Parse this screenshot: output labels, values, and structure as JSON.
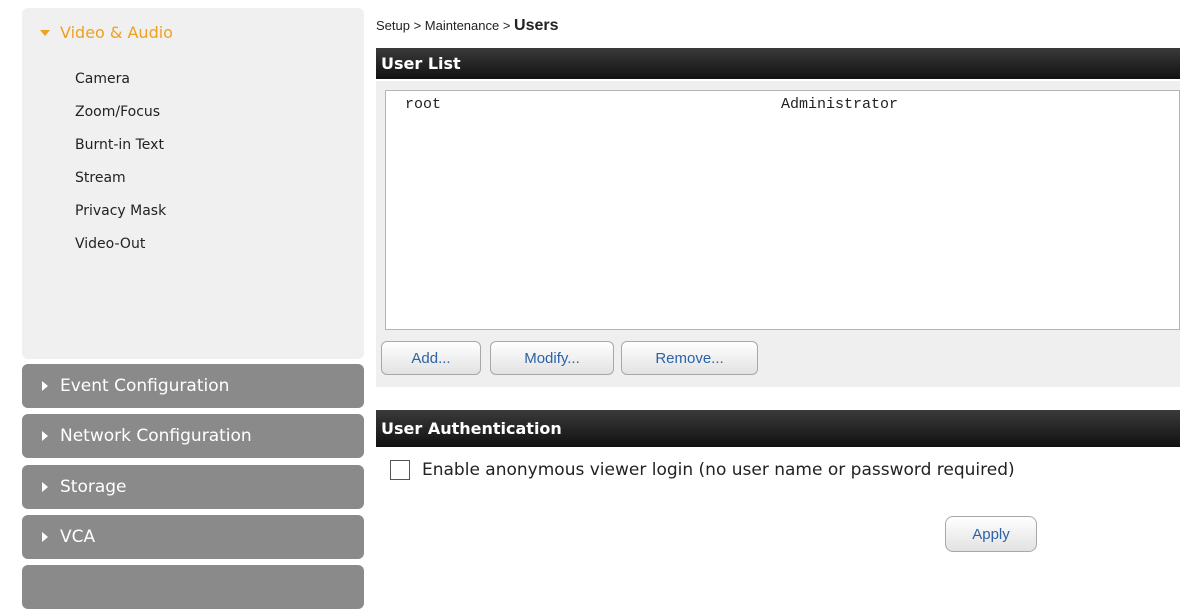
{
  "sidebar": {
    "open_section": {
      "label": "Video & Audio",
      "items": [
        "Camera",
        "Zoom/Focus",
        "Burnt-in Text",
        "Stream",
        "Privacy Mask",
        "Video-Out"
      ]
    },
    "closed_sections": [
      "Event Configuration",
      "Network Configuration",
      "Storage",
      "VCA"
    ]
  },
  "breadcrumb": {
    "path": "Setup > Maintenance > ",
    "current": "Users"
  },
  "user_list": {
    "title": "User List",
    "users": [
      {
        "name": "root",
        "role": "Administrator"
      }
    ],
    "buttons": {
      "add": "Add...",
      "modify": "Modify...",
      "remove": "Remove..."
    }
  },
  "user_auth": {
    "title": "User Authentication",
    "anonymous_label": "Enable anonymous viewer login (no user name or password required)",
    "anonymous_checked": false,
    "apply": "Apply"
  },
  "colors": {
    "accent": "#f0a020",
    "menu_closed_bg": "#8a8a8a",
    "header_bg": "#1a1a1a",
    "button_text": "#2b63a6"
  }
}
